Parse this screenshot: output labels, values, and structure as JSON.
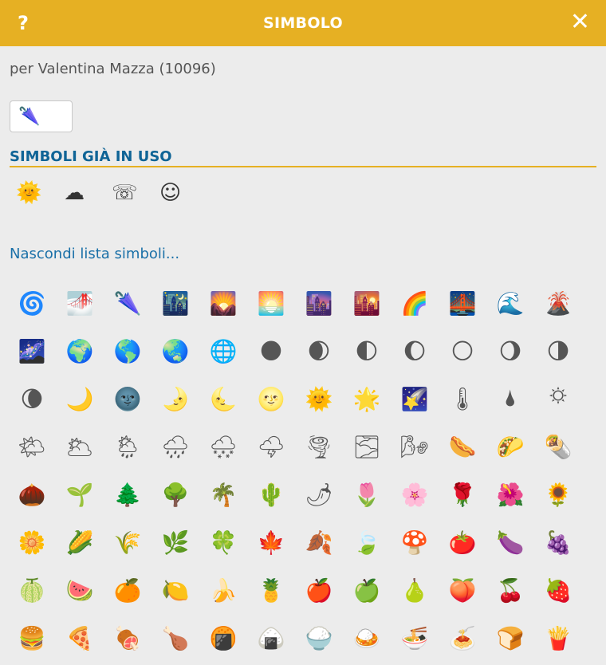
{
  "header": {
    "help_label": "?",
    "title": "SIMBOLO",
    "close_label": "✕"
  },
  "author": "per Valentina Mazza (10096)",
  "current_symbol": "🌂",
  "used_section": {
    "title": "SIMBOLI GIÀ IN USO",
    "symbols": [
      "🌞",
      "☁",
      "☏",
      "☺"
    ]
  },
  "toggle_link": "Nascondi lista simboli...",
  "symbols": [
    "🌀",
    "🌁",
    "🌂",
    "🌃",
    "🌄",
    "🌅",
    "🌆",
    "🌇",
    "🌈",
    "🌉",
    "🌊",
    "🌋",
    "🌌",
    "🌍",
    "🌎",
    "🌏",
    "🌐",
    "🌑",
    "🌒",
    "🌓",
    "🌔",
    "🌕",
    "🌖",
    "🌗",
    "🌘",
    "🌙",
    "🌚",
    "🌛",
    "🌜",
    "🌝",
    "🌞",
    "🌟",
    "🌠",
    "🌡",
    "🌢",
    "🌣",
    "🌤",
    "🌥",
    "🌦",
    "🌧",
    "🌨",
    "🌩",
    "🌪",
    "🌫",
    "🌬",
    "🌭",
    "🌮",
    "🌯",
    "🌰",
    "🌱",
    "🌲",
    "🌳",
    "🌴",
    "🌵",
    "🌶",
    "🌷",
    "🌸",
    "🌹",
    "🌺",
    "🌻",
    "🌼",
    "🌽",
    "🌾",
    "🌿",
    "🍀",
    "🍁",
    "🍂",
    "🍃",
    "🍄",
    "🍅",
    "🍆",
    "🍇",
    "🍈",
    "🍉",
    "🍊",
    "🍋",
    "🍌",
    "🍍",
    "🍎",
    "🍏",
    "🍐",
    "🍑",
    "🍒",
    "🍓",
    "🍔",
    "🍕",
    "🍖",
    "🍗",
    "🍘",
    "🍙",
    "🍚",
    "🍛",
    "🍜",
    "🍝",
    "🍞",
    "🍟"
  ],
  "colors": {
    "header_bg": "#e6b023",
    "link": "#1a70a8",
    "section_title": "#0f6496"
  }
}
